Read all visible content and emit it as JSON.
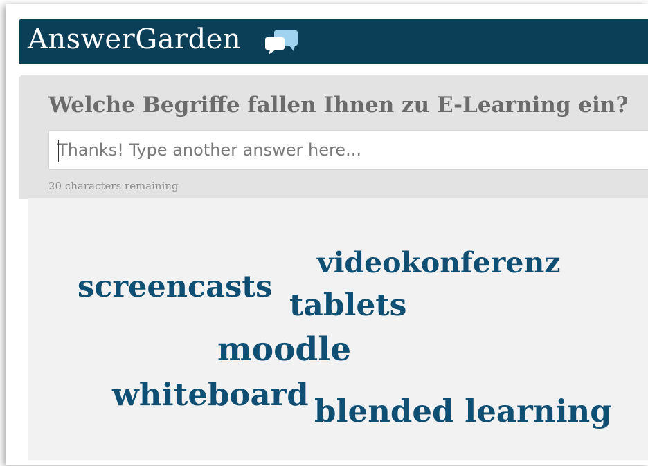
{
  "header": {
    "brand": "AnswerGarden",
    "brand_icon": "speech-bubbles-icon",
    "background_color": "#0b3f57"
  },
  "question_panel": {
    "question": "Welche Begriffe fallen Ihnen zu E-Learning ein?",
    "input_value": "",
    "input_placeholder": "Thanks! Type another answer here...",
    "remaining_text": "20 characters remaining"
  },
  "word_cloud": {
    "word_color": "#0f4f73",
    "words": [
      {
        "text": "videokonferenz"
      },
      {
        "text": "screencasts"
      },
      {
        "text": "tablets"
      },
      {
        "text": "moodle"
      },
      {
        "text": "whiteboard"
      },
      {
        "text": "blended learning"
      }
    ]
  }
}
